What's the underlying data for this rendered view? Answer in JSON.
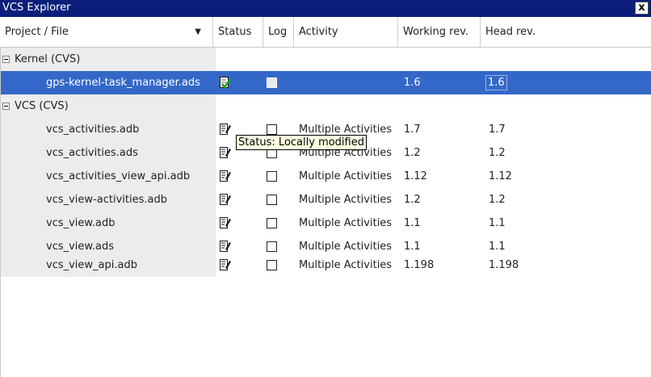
{
  "window": {
    "title": "VCS Explorer",
    "close_glyph": "x"
  },
  "columns": [
    {
      "label": "Project / File"
    },
    {
      "label": "Status"
    },
    {
      "label": "Log"
    },
    {
      "label": "Activity"
    },
    {
      "label": "Working rev."
    },
    {
      "label": "Head rev."
    }
  ],
  "sort_glyph": "▼",
  "groups": [
    {
      "label": "Kernel (CVS)"
    },
    {
      "label": "VCS (CVS)"
    }
  ],
  "files": [
    {
      "name": "gps-kernel-task_manager.ads",
      "activity": "",
      "working_rev": "1.6",
      "head_rev": "1.6",
      "status_icon": "up-to-date-icon"
    },
    {
      "name": "vcs_activities.adb",
      "activity": "Multiple Activities",
      "working_rev": "1.7",
      "head_rev": "1.7",
      "status_icon": "locally-modified-icon"
    },
    {
      "name": "vcs_activities.ads",
      "activity": "Multiple Activities",
      "working_rev": "1.2",
      "head_rev": "1.2",
      "status_icon": "locally-modified-icon"
    },
    {
      "name": "vcs_activities_view_api.adb",
      "activity": "Multiple Activities",
      "working_rev": "1.12",
      "head_rev": "1.12",
      "status_icon": "locally-modified-icon"
    },
    {
      "name": "vcs_view-activities.adb",
      "activity": "Multiple Activities",
      "working_rev": "1.2",
      "head_rev": "1.2",
      "status_icon": "locally-modified-icon"
    },
    {
      "name": "vcs_view.adb",
      "activity": "Multiple Activities",
      "working_rev": "1.1",
      "head_rev": "1.1",
      "status_icon": "locally-modified-icon"
    },
    {
      "name": "vcs_view.ads",
      "activity": "Multiple Activities",
      "working_rev": "1.1",
      "head_rev": "1.1",
      "status_icon": "locally-modified-icon"
    },
    {
      "name": "vcs_view_api.adb",
      "activity": "Multiple Activities",
      "working_rev": "1.198",
      "head_rev": "1.198",
      "status_icon": "locally-modified-icon"
    }
  ],
  "tooltip": {
    "text": "Status: Locally modified"
  },
  "colors": {
    "title_bar": "#0a1e7a",
    "selection": "#3468c8",
    "name_column_bg": "#ececec",
    "tooltip_bg": "#ffffe1"
  }
}
